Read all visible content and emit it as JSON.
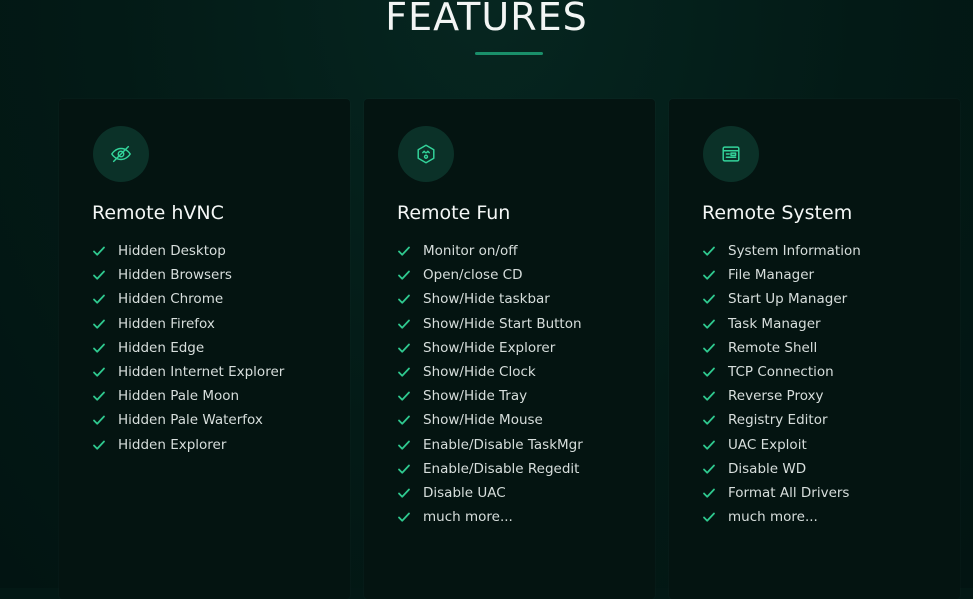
{
  "section": {
    "title": "FEATURES"
  },
  "colors": {
    "background": "#031815",
    "card": "#041411",
    "accent": "#2fc98f",
    "icon_circle": "#0b3128"
  },
  "cards": [
    {
      "icon": "eye-off-icon",
      "title": "Remote hVNC",
      "items": [
        "Hidden Desktop",
        "Hidden Browsers",
        "Hidden Chrome",
        "Hidden Firefox",
        "Hidden Edge",
        "Hidden Internet Explorer",
        "Hidden Pale Moon",
        "Hidden Pale Waterfox",
        "Hidden Explorer"
      ]
    },
    {
      "icon": "fun-face-icon",
      "title": "Remote Fun",
      "items": [
        "Monitor on/off",
        "Open/close CD",
        "Show/Hide taskbar",
        "Show/Hide Start Button",
        "Show/Hide Explorer",
        "Show/Hide Clock",
        "Show/Hide Tray",
        "Show/Hide Mouse",
        "Enable/Disable TaskMgr",
        "Enable/Disable Regedit",
        "Disable UAC",
        "much more..."
      ]
    },
    {
      "icon": "system-window-icon",
      "title": "Remote System",
      "items": [
        "System Information",
        "File Manager",
        "Start Up Manager",
        "Task Manager",
        "Remote Shell",
        "TCP Connection",
        "Reverse Proxy",
        "Registry Editor",
        "UAC Exploit",
        "Disable WD",
        "Format All Drivers",
        "much more..."
      ]
    }
  ]
}
